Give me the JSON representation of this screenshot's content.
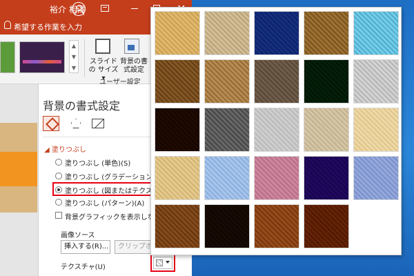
{
  "titlebar": {
    "user_name": "裕介 相澤",
    "icons": [
      "user-avatar-icon",
      "ribbon-display-options-icon",
      "minimize-icon",
      "maximize-icon",
      "close-icon"
    ],
    "close_glyph": "✕",
    "color": "#c43e1c"
  },
  "tellme": {
    "placeholder": "希望する作業を入力",
    "icon": "lightbulb-icon"
  },
  "ribbon": {
    "slide_size_label": "スライドの サイズ",
    "slide_size_caret": "▾",
    "format_background_label": "背景の書 式設定",
    "group_label": "ユーザー設定",
    "gallery_scroll": [
      "▲",
      "▼",
      "▼"
    ]
  },
  "pane": {
    "title": "背景の書式設定",
    "tabs": [
      "fill-tab-icon",
      "effects-pentagon-icon",
      "picture-tab-icon"
    ],
    "section_label": "◢ 塗りつぶし",
    "options": [
      {
        "label": "塗りつぶし (単色)(S)",
        "selected": false
      },
      {
        "label": "塗りつぶし (グラデーション)(G)",
        "selected": false
      },
      {
        "label": "塗りつぶし (図またはテクスチャ)(P)",
        "selected": true
      },
      {
        "label": "塗りつぶし (パターン)(A)",
        "selected": false
      }
    ],
    "hide_graphics_label": "背景グラフィックを表示しない(H)",
    "image_source_label": "画像ソース",
    "insert_button": "挿入する(R)...",
    "clipboard_button": "クリップボード",
    "texture_label": "テクスチャ(U)",
    "highlight_color": "#e60012"
  },
  "texture_popup": {
    "textures": [
      {
        "name": "papyrus",
        "colors": [
          "#efd9a6",
          "#d9bb80"
        ]
      },
      {
        "name": "canvas",
        "colors": [
          "#e8dcc4",
          "#cbbd9e"
        ]
      },
      {
        "name": "denim",
        "colors": [
          "#4a6fb5",
          "#2e4f92"
        ]
      },
      {
        "name": "woven-mat",
        "colors": [
          "#c9aa72",
          "#9a7c45"
        ]
      },
      {
        "name": "water-droplets",
        "colors": [
          "#aee4f2",
          "#6cc2dc"
        ]
      },
      {
        "name": "paper-bag",
        "colors": [
          "#b89560",
          "#8a6b3c"
        ]
      },
      {
        "name": "fish-fossil",
        "colors": [
          "#d8bd91",
          "#b0915f"
        ]
      },
      {
        "name": "sand",
        "colors": [
          "#a89a8a",
          "#857565"
        ]
      },
      {
        "name": "green-marble",
        "colors": [
          "#1f5a32",
          "#0e3a1c"
        ]
      },
      {
        "name": "white-marble",
        "colors": [
          "#e8e8e8",
          "#c6c6c6"
        ]
      },
      {
        "name": "brown-marble",
        "colors": [
          "#5a3318",
          "#35200e"
        ]
      },
      {
        "name": "granite",
        "colors": [
          "#a2a2a2",
          "#6e6e6e"
        ]
      },
      {
        "name": "newsprint",
        "colors": [
          "#e5e5e5",
          "#cfcfcf"
        ]
      },
      {
        "name": "recycled-paper",
        "colors": [
          "#e9e1cf",
          "#d4c9ae"
        ]
      },
      {
        "name": "parchment",
        "colors": [
          "#f6ebcf",
          "#e9d6a9"
        ]
      },
      {
        "name": "stationery",
        "colors": [
          "#f1e3bf",
          "#dfc995"
        ]
      },
      {
        "name": "blue-tissue-paper",
        "colors": [
          "#cfe0f4",
          "#a9c6ea"
        ]
      },
      {
        "name": "pink-tissue-paper",
        "colors": [
          "#e4b9c8",
          "#cf98ad"
        ]
      },
      {
        "name": "purple-mesh",
        "colors": [
          "#5c2f9e",
          "#3c1a75"
        ]
      },
      {
        "name": "bouquet",
        "colors": [
          "#c3cfec",
          "#9eb1dd"
        ]
      },
      {
        "name": "cork",
        "colors": [
          "#b88a53",
          "#8e6433"
        ]
      },
      {
        "name": "walnut",
        "colors": [
          "#4e3320",
          "#2e1d10"
        ]
      },
      {
        "name": "oak",
        "colors": [
          "#c48a52",
          "#9a6532"
        ]
      },
      {
        "name": "medium-wood",
        "colors": [
          "#a15e26",
          "#7a4316"
        ]
      }
    ]
  },
  "desktop": {
    "wallpaper_color": "#2b86d9"
  }
}
